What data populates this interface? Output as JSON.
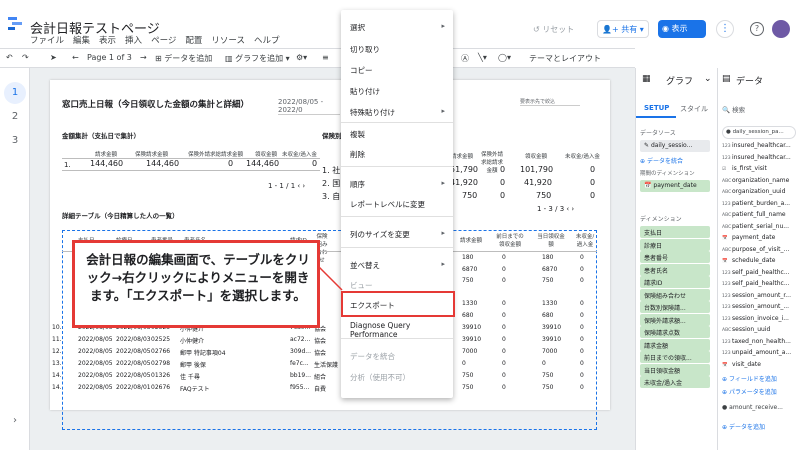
{
  "app": {
    "title": "会計日報テストページ"
  },
  "menu": [
    "ファイル",
    "編集",
    "表示",
    "挿入",
    "ページ",
    "配置",
    "リソース",
    "ヘルプ"
  ],
  "header": {
    "reset": "リセット",
    "share": "共有",
    "view": "表示"
  },
  "toolbar": {
    "page": "Page 1 of 3",
    "add_data": "データを追加",
    "add_chart": "グラフを追加",
    "theme": "テーマとレイアウト"
  },
  "pages": [
    "1",
    "2",
    "3"
  ],
  "report": {
    "title": "窓口売上日報（今日領収した金額の集計と詳細）",
    "date_range": "2022/08/05 - 2022/0",
    "filter_placeholder": "要表示先で絞込",
    "summary1": {
      "title": "金額集計（支払日で集計）",
      "headers": [
        "請求金額",
        "保険請求金額",
        "保険外請求総請求金額",
        "領収金額",
        "未収金/過入金"
      ],
      "row": [
        "1.",
        "144,460",
        "144,460",
        "0",
        "144,460",
        "0"
      ],
      "pager": "1 - 1 / 1"
    },
    "summary2": {
      "title": "保険別",
      "headers": [
        "請求金額",
        "保険外請求総請求金額",
        "領収金額",
        "未収金/過入金"
      ],
      "rows": [
        [
          "1.",
          "社",
          "51,790",
          "0",
          "101,790",
          "0"
        ],
        [
          "2.",
          "国",
          "41,920",
          "0",
          "41,920",
          "0"
        ],
        [
          "3.",
          "自",
          "750",
          "0",
          "750",
          "0"
        ]
      ],
      "pager": "1 - 3 / 3"
    },
    "detail": {
      "title": "詳細テーブル（今日精算した人の一覧）",
      "headers": [
        "支払日",
        "診療日",
        "患者番号",
        "患者氏名",
        "請求ID",
        "保険組み合わせ",
        "請求金額",
        "前日までの領収金額",
        "当日領収金額",
        "未収金/過入金"
      ],
      "rows": [
        [
          "10.",
          "2022/08/05",
          "2022/08/03",
          "02525",
          "小仲健介",
          "7ca0...",
          "協会",
          "39910",
          "0",
          "39910",
          "0"
        ],
        [
          "11.",
          "2022/08/05",
          "2022/08/03",
          "02525",
          "小仲健介",
          "ac72...",
          "協会",
          "39910",
          "0",
          "39910",
          "0"
        ],
        [
          "12.",
          "2022/08/05",
          "2022/08/05",
          "02766",
          "郵甲 特記事項04",
          "309d...",
          "協会",
          "7000",
          "0",
          "7000",
          "0"
        ],
        [
          "13.",
          "2022/08/05",
          "2022/08/05",
          "02798",
          "郵甲 後保",
          "fe7c...",
          "生活保護",
          "0",
          "0",
          "0",
          "0"
        ],
        [
          "14.",
          "2022/08/05",
          "2022/08/05",
          "01326",
          "佳 千尋",
          "bb19...",
          "組合",
          "750",
          "0",
          "750",
          "0"
        ],
        [
          "14.",
          "2022/08/05",
          "2022/08/01",
          "02676",
          "FAQテスト",
          "f955...",
          "自費",
          "750",
          "0",
          "750",
          "0"
        ]
      ],
      "right_rows": [
        [
          "180",
          "0",
          "180",
          "0"
        ],
        [
          "6870",
          "0",
          "6870",
          "0"
        ],
        [
          "750",
          "0",
          "750",
          "0"
        ],
        [
          "",
          "",
          "",
          ""
        ],
        [
          "1330",
          "0",
          "1330",
          "0"
        ],
        [
          "680",
          "0",
          "680",
          "0"
        ]
      ]
    }
  },
  "context_menu": {
    "items": [
      {
        "label": "選択",
        "submenu": true
      },
      {
        "label": "切り取り"
      },
      {
        "label": "コピー"
      },
      {
        "label": "貼り付け"
      },
      {
        "label": "特殊貼り付け",
        "submenu": true
      },
      {
        "label": "複製"
      },
      {
        "label": "削除"
      },
      {
        "label": "順序",
        "submenu": true
      },
      {
        "label": "レポートレベルに変更"
      },
      {
        "label": "列のサイズを変更",
        "submenu": true
      },
      {
        "label": "並べ替え",
        "submenu": true
      },
      {
        "label": "ビュー"
      },
      {
        "label": "エクスポート"
      },
      {
        "label": "Diagnose Query Performance"
      },
      {
        "label": "データを統合",
        "disabled": true
      },
      {
        "label": "分析（使用不可）",
        "disabled": true
      }
    ]
  },
  "callout": {
    "text": "会計日報の編集画面で、テーブルをクリック→右クリックによりメニューを開きます。「エクスポート」を選択します。"
  },
  "props_panel": {
    "title": "グラフ",
    "tabs": [
      "SETUP",
      "スタイル"
    ],
    "datasource_label": "データソース",
    "datasource": "daily_sessio...",
    "blend": "データを統合",
    "date_dimension_label": "期間のディメンション",
    "date_dimension": "payment_date",
    "dimension_label": "ディメンション",
    "dimensions": [
      "支払日",
      "診療日",
      "患者番号",
      "患者氏名",
      "請求ID",
      "保険組み合わせ",
      "台数別保険請...",
      "保険外請求額...",
      "保険請求点数",
      "請求金額",
      "前日までの領収...",
      "当日領収金額",
      "未収金/過入金"
    ]
  },
  "data_panel": {
    "title": "データ",
    "search_placeholder": "検索",
    "source": "daily_session_pa...",
    "fields": [
      {
        "type": "123",
        "name": "insured_healthcar..."
      },
      {
        "type": "123",
        "name": "insured_healthcar..."
      },
      {
        "type": "☑",
        "name": "is_first_visit"
      },
      {
        "type": "ABC",
        "name": "organization_name"
      },
      {
        "type": "ABC",
        "name": "organization_uuid"
      },
      {
        "type": "123",
        "name": "patient_burden_a..."
      },
      {
        "type": "ABC",
        "name": "patient_full_name"
      },
      {
        "type": "ABC",
        "name": "patient_serial_nu..."
      },
      {
        "type": "📅",
        "name": "payment_date"
      },
      {
        "type": "ABC",
        "name": "purpose_of_visit_..."
      },
      {
        "type": "📅",
        "name": "schedule_date"
      },
      {
        "type": "123",
        "name": "self_paid_healthc..."
      },
      {
        "type": "123",
        "name": "self_paid_healthc..."
      },
      {
        "type": "123",
        "name": "session_amount_r..."
      },
      {
        "type": "123",
        "name": "session_amount_..."
      },
      {
        "type": "123",
        "name": "session_invoice_i..."
      },
      {
        "type": "ABC",
        "name": "session_uuid"
      },
      {
        "type": "123",
        "name": "taxed_non_health..."
      },
      {
        "type": "123",
        "name": "unpaid_amount_a..."
      },
      {
        "type": "📅",
        "name": "visit_date"
      }
    ],
    "add_field": "フィールドを追加",
    "add_param": "パラメータを追加",
    "source2": "amount_receive...",
    "add_data": "データを追加"
  }
}
